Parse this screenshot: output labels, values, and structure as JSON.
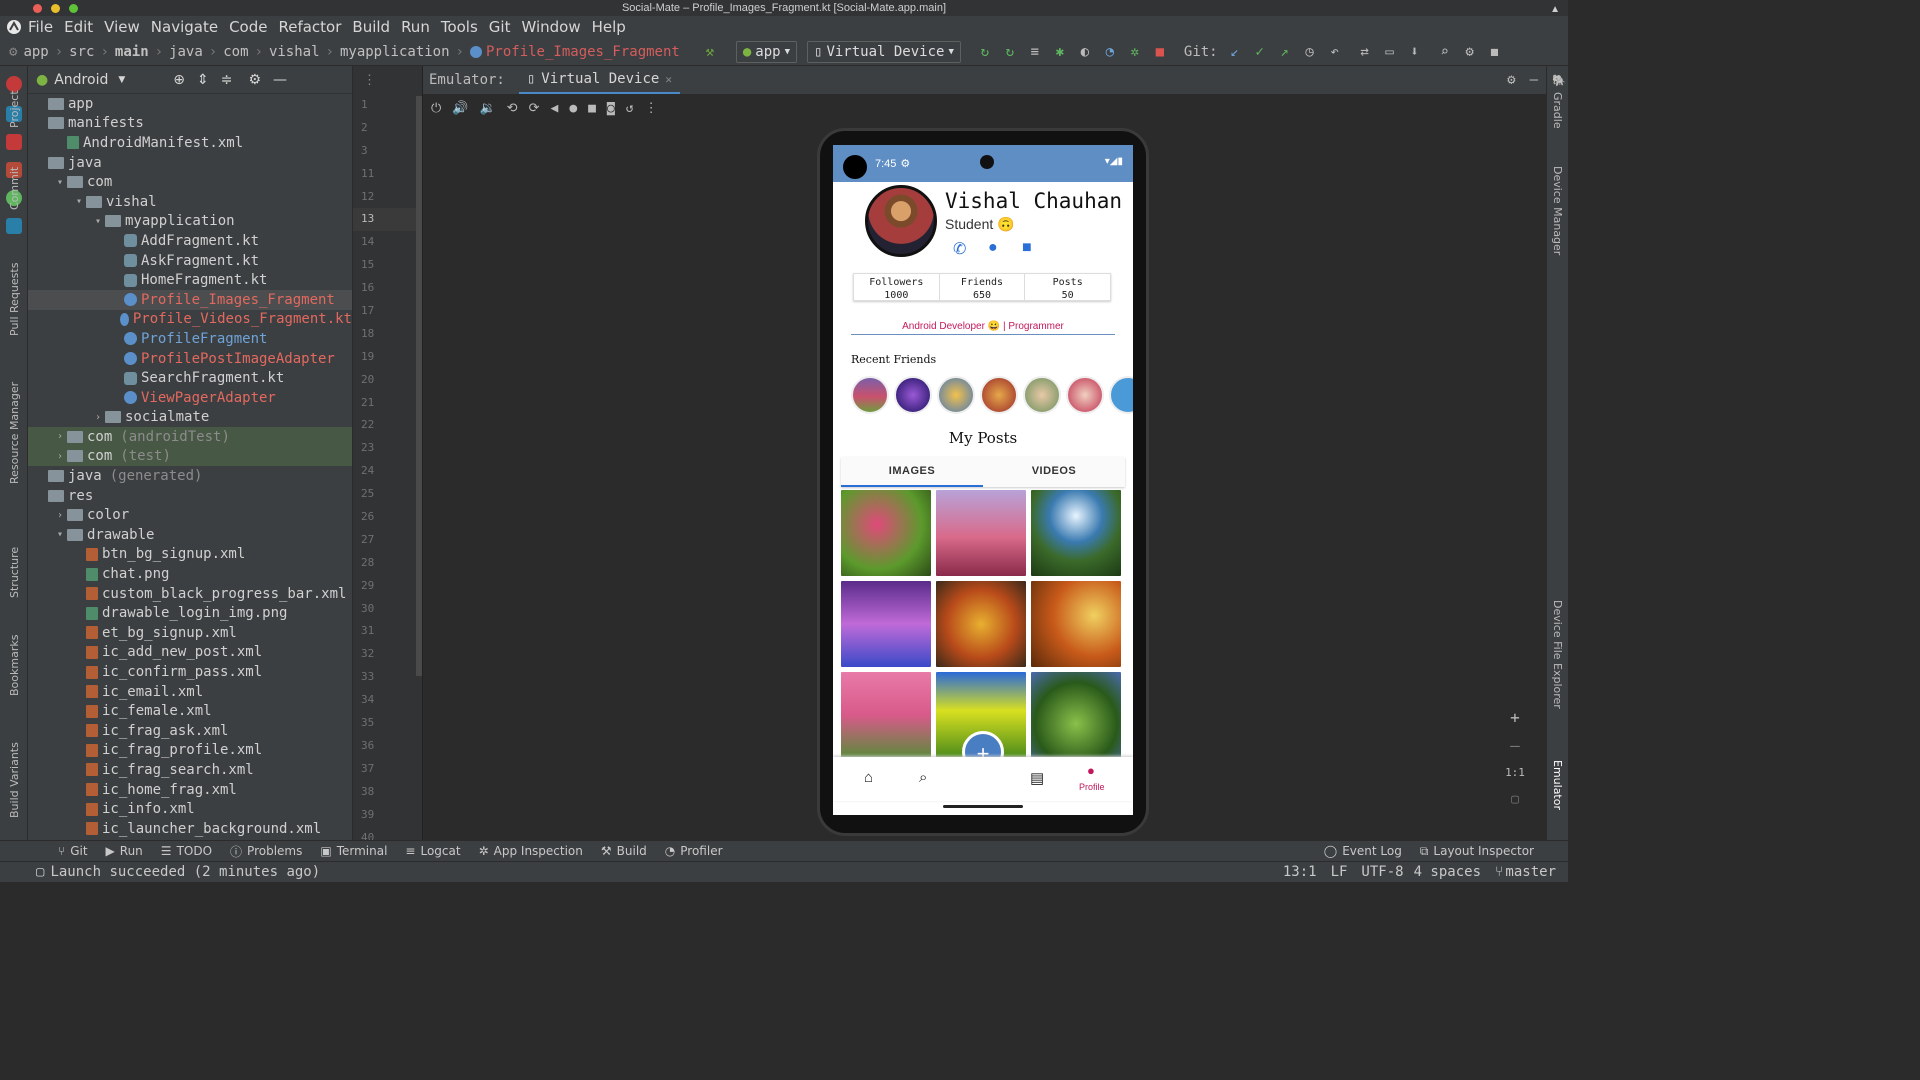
{
  "window": {
    "title": "Social-Mate – Profile_Images_Fragment.kt [Social-Mate.app.main]"
  },
  "menu": [
    "File",
    "Edit",
    "View",
    "Navigate",
    "Code",
    "Refactor",
    "Build",
    "Run",
    "Tools",
    "Git",
    "Window",
    "Help"
  ],
  "breadcrumb": [
    "app",
    "src",
    "main",
    "java",
    "com",
    "vishal",
    "myapplication",
    "Profile_Images_Fragment"
  ],
  "toolbar": {
    "run_config": "app",
    "device": "Virtual Device",
    "git_label": "Git:"
  },
  "left_strip": {
    "project": "Project",
    "commit": "Commit",
    "pull_requests": "Pull Requests",
    "resource_manager": "Resource Manager",
    "structure": "Structure",
    "bookmarks": "Bookmarks",
    "build_variants": "Build Variants"
  },
  "project_panel": {
    "view": "Android",
    "tree": [
      {
        "label": "app",
        "indent": 0,
        "icon": "folder",
        "arrow": ""
      },
      {
        "label": "manifests",
        "indent": 0,
        "icon": "folder",
        "arrow": ""
      },
      {
        "label": "AndroidManifest.xml",
        "indent": 1,
        "icon": "manifest",
        "arrow": ""
      },
      {
        "label": "java",
        "indent": 0,
        "icon": "folder",
        "arrow": ""
      },
      {
        "label": "com",
        "indent": 1,
        "icon": "folder",
        "arrow": "v"
      },
      {
        "label": "vishal",
        "indent": 2,
        "icon": "folder",
        "arrow": "v"
      },
      {
        "label": "myapplication",
        "indent": 3,
        "icon": "folder",
        "arrow": "v"
      },
      {
        "label": "AddFragment.kt",
        "indent": 4,
        "icon": "kt",
        "arrow": ""
      },
      {
        "label": "AskFragment.kt",
        "indent": 4,
        "icon": "kt",
        "arrow": ""
      },
      {
        "label": "HomeFragment.kt",
        "indent": 4,
        "icon": "kt",
        "arrow": ""
      },
      {
        "label": "Profile_Images_Fragment",
        "indent": 4,
        "icon": "class",
        "arrow": "",
        "color": "red",
        "selected": true
      },
      {
        "label": "Profile_Videos_Fragment.kt",
        "indent": 4,
        "icon": "class",
        "arrow": "",
        "color": "red"
      },
      {
        "label": "ProfileFragment",
        "indent": 4,
        "icon": "class",
        "arrow": "",
        "color": "blue"
      },
      {
        "label": "ProfilePostImageAdapter",
        "indent": 4,
        "icon": "class",
        "arrow": "",
        "color": "red"
      },
      {
        "label": "SearchFragment.kt",
        "indent": 4,
        "icon": "kt",
        "arrow": ""
      },
      {
        "label": "ViewPagerAdapter",
        "indent": 4,
        "icon": "class",
        "arrow": "",
        "color": "red"
      },
      {
        "label": "socialmate",
        "indent": 3,
        "icon": "folder",
        "arrow": ">"
      },
      {
        "label": "com",
        "suffix": "(androidTest)",
        "indent": 1,
        "icon": "folder",
        "arrow": ">",
        "test": true
      },
      {
        "label": "com",
        "suffix": "(test)",
        "indent": 1,
        "icon": "folder",
        "arrow": ">",
        "test": true
      },
      {
        "label": "java",
        "suffix": "(generated)",
        "indent": 0,
        "icon": "folder",
        "arrow": ""
      },
      {
        "label": "res",
        "indent": 0,
        "icon": "folder",
        "arrow": ""
      },
      {
        "label": "color",
        "indent": 1,
        "icon": "folder",
        "arrow": ">"
      },
      {
        "label": "drawable",
        "indent": 1,
        "icon": "folder",
        "arrow": "v"
      },
      {
        "label": "btn_bg_signup.xml",
        "indent": 2,
        "icon": "xml",
        "arrow": ""
      },
      {
        "label": "chat.png",
        "indent": 2,
        "icon": "img",
        "arrow": ""
      },
      {
        "label": "custom_black_progress_bar.xml",
        "indent": 2,
        "icon": "xml",
        "arrow": ""
      },
      {
        "label": "drawable_login_img.png",
        "indent": 2,
        "icon": "img",
        "arrow": ""
      },
      {
        "label": "et_bg_signup.xml",
        "indent": 2,
        "icon": "xml",
        "arrow": ""
      },
      {
        "label": "ic_add_new_post.xml",
        "indent": 2,
        "icon": "xml",
        "arrow": ""
      },
      {
        "label": "ic_confirm_pass.xml",
        "indent": 2,
        "icon": "xml",
        "arrow": ""
      },
      {
        "label": "ic_email.xml",
        "indent": 2,
        "icon": "xml",
        "arrow": ""
      },
      {
        "label": "ic_female.xml",
        "indent": 2,
        "icon": "xml",
        "arrow": ""
      },
      {
        "label": "ic_frag_ask.xml",
        "indent": 2,
        "icon": "xml",
        "arrow": ""
      },
      {
        "label": "ic_frag_profile.xml",
        "indent": 2,
        "icon": "xml",
        "arrow": ""
      },
      {
        "label": "ic_frag_search.xml",
        "indent": 2,
        "icon": "xml",
        "arrow": ""
      },
      {
        "label": "ic_home_frag.xml",
        "indent": 2,
        "icon": "xml",
        "arrow": ""
      },
      {
        "label": "ic_info.xml",
        "indent": 2,
        "icon": "xml",
        "arrow": ""
      },
      {
        "label": "ic_launcher_background.xml",
        "indent": 2,
        "icon": "xml",
        "arrow": ""
      }
    ]
  },
  "gutter": {
    "lines": [
      "1",
      "2",
      "3",
      "11",
      "12",
      "13",
      "14",
      "15",
      "16",
      "17",
      "18",
      "19",
      "20",
      "21",
      "22",
      "23",
      "24",
      "25",
      "26",
      "27",
      "28",
      "29",
      "30",
      "31",
      "32",
      "33",
      "34",
      "35",
      "36",
      "37",
      "38",
      "39",
      "40"
    ]
  },
  "emulator": {
    "label": "Emulator:",
    "tab": "Virtual Device",
    "zoom_ratio": "1:1"
  },
  "phone": {
    "time": "7:45",
    "name": "Vishal Chauhan",
    "subtitle": "Student 🙃",
    "stats": [
      {
        "label": "Followers",
        "value": "1000"
      },
      {
        "label": "Friends",
        "value": "650"
      },
      {
        "label": "Posts",
        "value": "50"
      }
    ],
    "bio": "Android Developer 😀 | Programmer",
    "recent_friends": "Recent Friends",
    "my_posts": "My Posts",
    "tabs": [
      "IMAGES",
      "VIDEOS"
    ],
    "nav_profile": "Profile"
  },
  "right_strip": {
    "gradle": "Gradle",
    "device_manager": "Device Manager",
    "device_file_explorer": "Device File Explorer",
    "emulator": "Emulator"
  },
  "bottom_tabs": [
    "Git",
    "Run",
    "TODO",
    "Problems",
    "Terminal",
    "Logcat",
    "App Inspection",
    "Build",
    "Profiler"
  ],
  "bottom_right_tabs": [
    "Event Log",
    "Layout Inspector"
  ],
  "status": {
    "message": "Launch succeeded (2 minutes ago)",
    "position": "13:1",
    "line_sep": "LF",
    "encoding": "UTF-8",
    "indent": "4 spaces",
    "branch": "master"
  }
}
